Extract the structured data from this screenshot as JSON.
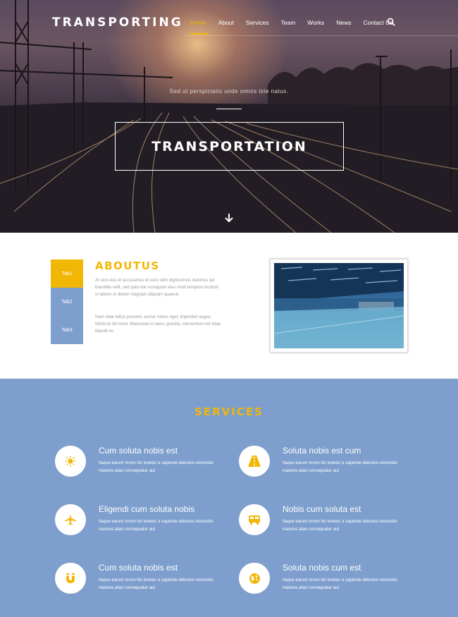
{
  "header": {
    "logo": "TRANSPORTING",
    "nav": [
      "Home",
      "About",
      "Services",
      "Team",
      "Works",
      "News",
      "Contact Us"
    ],
    "active_nav": "Home",
    "search_icon": "search-icon"
  },
  "hero": {
    "subtitle": "Sed ut perspiciatis unde omnis iste natus.",
    "title": "TRANSPORTATION",
    "scroll_icon": "arrow-down-icon"
  },
  "about": {
    "title": "ABOUTUS",
    "tabs": [
      "Tab1",
      "Tab2",
      "Tab3"
    ],
    "paragraph1": "At vero eos et accusamus et iusto odio dignissimos ducimus qui blanditiis velit, sed quia non numquam eius modi tempora incidunt ut labore et dolore magnam aliquam quaerat.",
    "paragraph2": "Nam vitae tellus posuere, auctor metus eget, imperdiet augue. Morbi at elit tortor. Maecenas in lacus gravida, elementum est vitae, blandit ex."
  },
  "services": {
    "title": "SERVICES",
    "items": [
      {
        "name": "Cum soluta nobis est",
        "desc": "Itaque earum rerum hic tenetur a sapiente delectus reiciendis maiores alias consequatur aut",
        "icon": "sun-icon"
      },
      {
        "name": "Soluta nobis est cum",
        "desc": "Itaque earum rerum hic tenetur a sapiente delectus reiciendis maiores alias consequatur aut",
        "icon": "road-icon"
      },
      {
        "name": "Eligendi cum soluta nobis",
        "desc": "Itaque earum rerum hic tenetur a sapiente delectus reiciendis maiores alias consequatur aut",
        "icon": "airplane-icon"
      },
      {
        "name": "Nobis cum soluta est",
        "desc": "Itaque earum rerum hic tenetur a sapiente delectus reiciendis maiores alias consequatur aut",
        "icon": "bus-icon"
      },
      {
        "name": "Cum soluta nobis est",
        "desc": "Itaque earum rerum hic tenetur a sapiente delectus reiciendis maiores alias consequatur aut",
        "icon": "magnet-icon"
      },
      {
        "name": "Soluta nobis cum est",
        "desc": "Itaque earum rerum hic tenetur a sapiente delectus reiciendis maiores alias consequatur aut",
        "icon": "globe-icon"
      }
    ]
  },
  "colors": {
    "accent": "#f2b705",
    "services_bg": "#7e9fcd",
    "tab_bg": "#7e9fcd"
  }
}
